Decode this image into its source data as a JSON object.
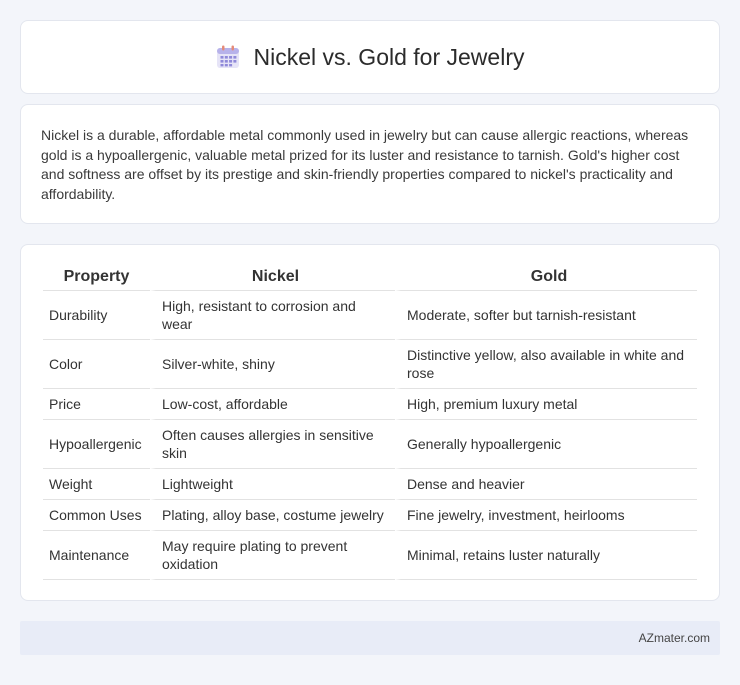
{
  "header": {
    "title": "Nickel vs. Gold for Jewelry",
    "icon": "calendar-icon"
  },
  "intro": {
    "text": "Nickel is a durable, affordable metal commonly used in jewelry but can cause allergic reactions, whereas gold is a hypoallergenic, valuable metal prized for its luster and resistance to tarnish. Gold's higher cost and softness are offset by its prestige and skin-friendly properties compared to nickel's practicality and affordability."
  },
  "table": {
    "headers": [
      "Property",
      "Nickel",
      "Gold"
    ],
    "rows": [
      [
        "Durability",
        "High, resistant to corrosion and wear",
        "Moderate, softer but tarnish-resistant"
      ],
      [
        "Color",
        "Silver-white, shiny",
        "Distinctive yellow, also available in white and rose"
      ],
      [
        "Price",
        "Low-cost, affordable",
        "High, premium luxury metal"
      ],
      [
        "Hypoallergenic",
        "Often causes allergies in sensitive skin",
        "Generally hypoallergenic"
      ],
      [
        "Weight",
        "Lightweight",
        "Dense and heavier"
      ],
      [
        "Common Uses",
        "Plating, alloy base, costume jewelry",
        "Fine jewelry, investment, heirlooms"
      ],
      [
        "Maintenance",
        "May require plating to prevent oxidation",
        "Minimal, retains luster naturally"
      ]
    ]
  },
  "footer": {
    "text": "AZmater.com"
  }
}
